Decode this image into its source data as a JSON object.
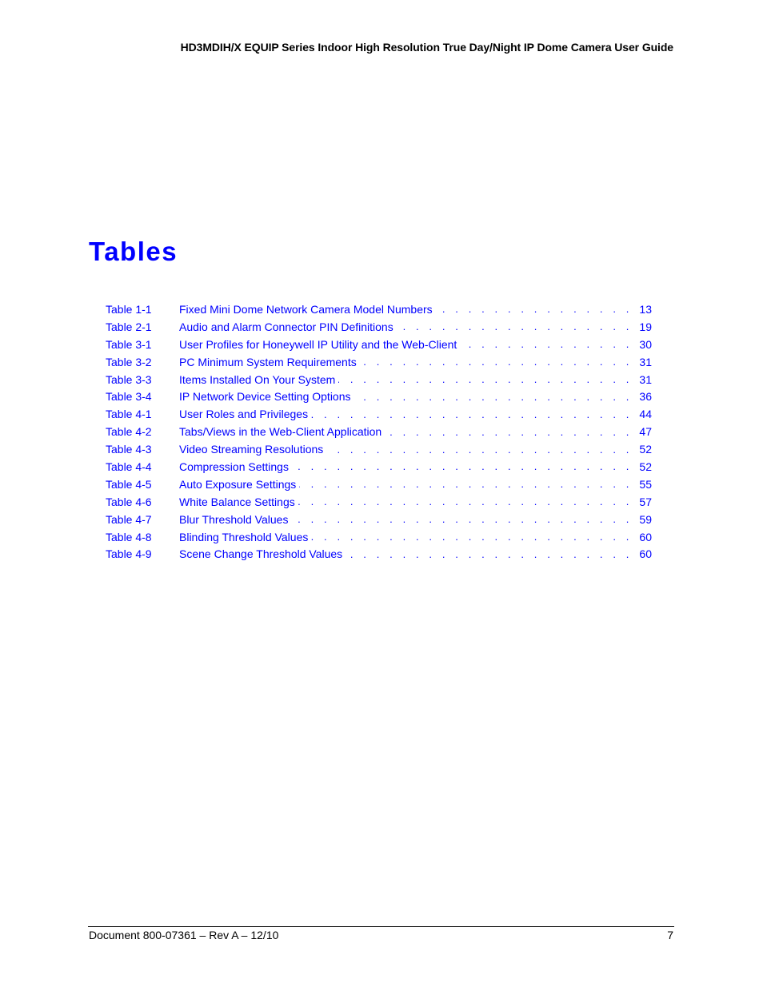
{
  "header": {
    "running_title": "HD3MDIH/X EQUIP Series Indoor High Resolution True Day/Night IP Dome Camera User Guide"
  },
  "page_title": "Tables",
  "colors": {
    "link": "#0000ff",
    "text": "#000000"
  },
  "toc": {
    "dot_leader": ". . . . . . . . . . . . . . . . . . . . . . . . . . . . . . . . . . . . . . . . . . . . . . . . . . .",
    "items": [
      {
        "number": "Table 1-1",
        "title": "Fixed Mini Dome Network Camera Model Numbers",
        "page": "13"
      },
      {
        "number": "Table 2-1",
        "title": "Audio and Alarm Connector PIN Definitions",
        "page": "19"
      },
      {
        "number": "Table 3-1",
        "title": "User Profiles for Honeywell IP Utility and the Web-Client",
        "page": "30"
      },
      {
        "number": "Table 3-2",
        "title": "PC Minimum System Requirements",
        "page": "31"
      },
      {
        "number": "Table 3-3",
        "title": "Items Installed On Your System",
        "page": "31"
      },
      {
        "number": "Table 3-4",
        "title": "IP Network Device Setting Options",
        "page": "36"
      },
      {
        "number": "Table 4-1",
        "title": "User Roles and Privileges",
        "page": "44"
      },
      {
        "number": "Table 4-2",
        "title": "Tabs/Views in the Web-Client Application",
        "page": "47"
      },
      {
        "number": "Table 4-3",
        "title": "Video Streaming Resolutions",
        "page": "52"
      },
      {
        "number": "Table 4-4",
        "title": "Compression Settings",
        "page": "52"
      },
      {
        "number": "Table 4-5",
        "title": "Auto Exposure Settings",
        "page": "55"
      },
      {
        "number": "Table 4-6",
        "title": "White Balance Settings",
        "page": "57"
      },
      {
        "number": "Table 4-7",
        "title": "Blur Threshold Values",
        "page": "59"
      },
      {
        "number": "Table 4-8",
        "title": "Blinding Threshold Values",
        "page": "60"
      },
      {
        "number": "Table 4-9",
        "title": "Scene Change Threshold Values",
        "page": "60"
      }
    ]
  },
  "footer": {
    "document": "Document 800-07361 – Rev A – 12/10",
    "page_number": "7"
  }
}
